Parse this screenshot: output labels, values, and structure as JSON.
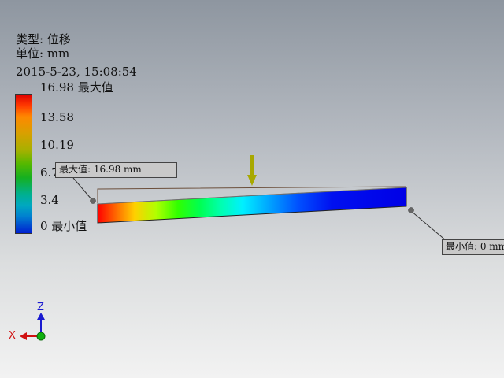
{
  "result_info": {
    "type_line": "类型: 位移",
    "unit_line": "单位: mm",
    "timestamp": "2015-5-23, 15:08:54"
  },
  "legend": {
    "max_label": "16.98 最大值",
    "ticks": [
      "13.58",
      "10.19",
      "6.79",
      "3.4"
    ],
    "min_label": "0 最小值"
  },
  "callouts": {
    "max": "最大值: 16.98 mm",
    "min": "最小值: 0 mm"
  },
  "triad": {
    "z_label": "Z",
    "x_label": "X"
  },
  "colors": {
    "load_arrow": "#a8a800",
    "beam_end": "#0000e6",
    "triad_z": "#1a1ad0",
    "triad_x": "#d01010",
    "triad_y": "#10b010"
  }
}
